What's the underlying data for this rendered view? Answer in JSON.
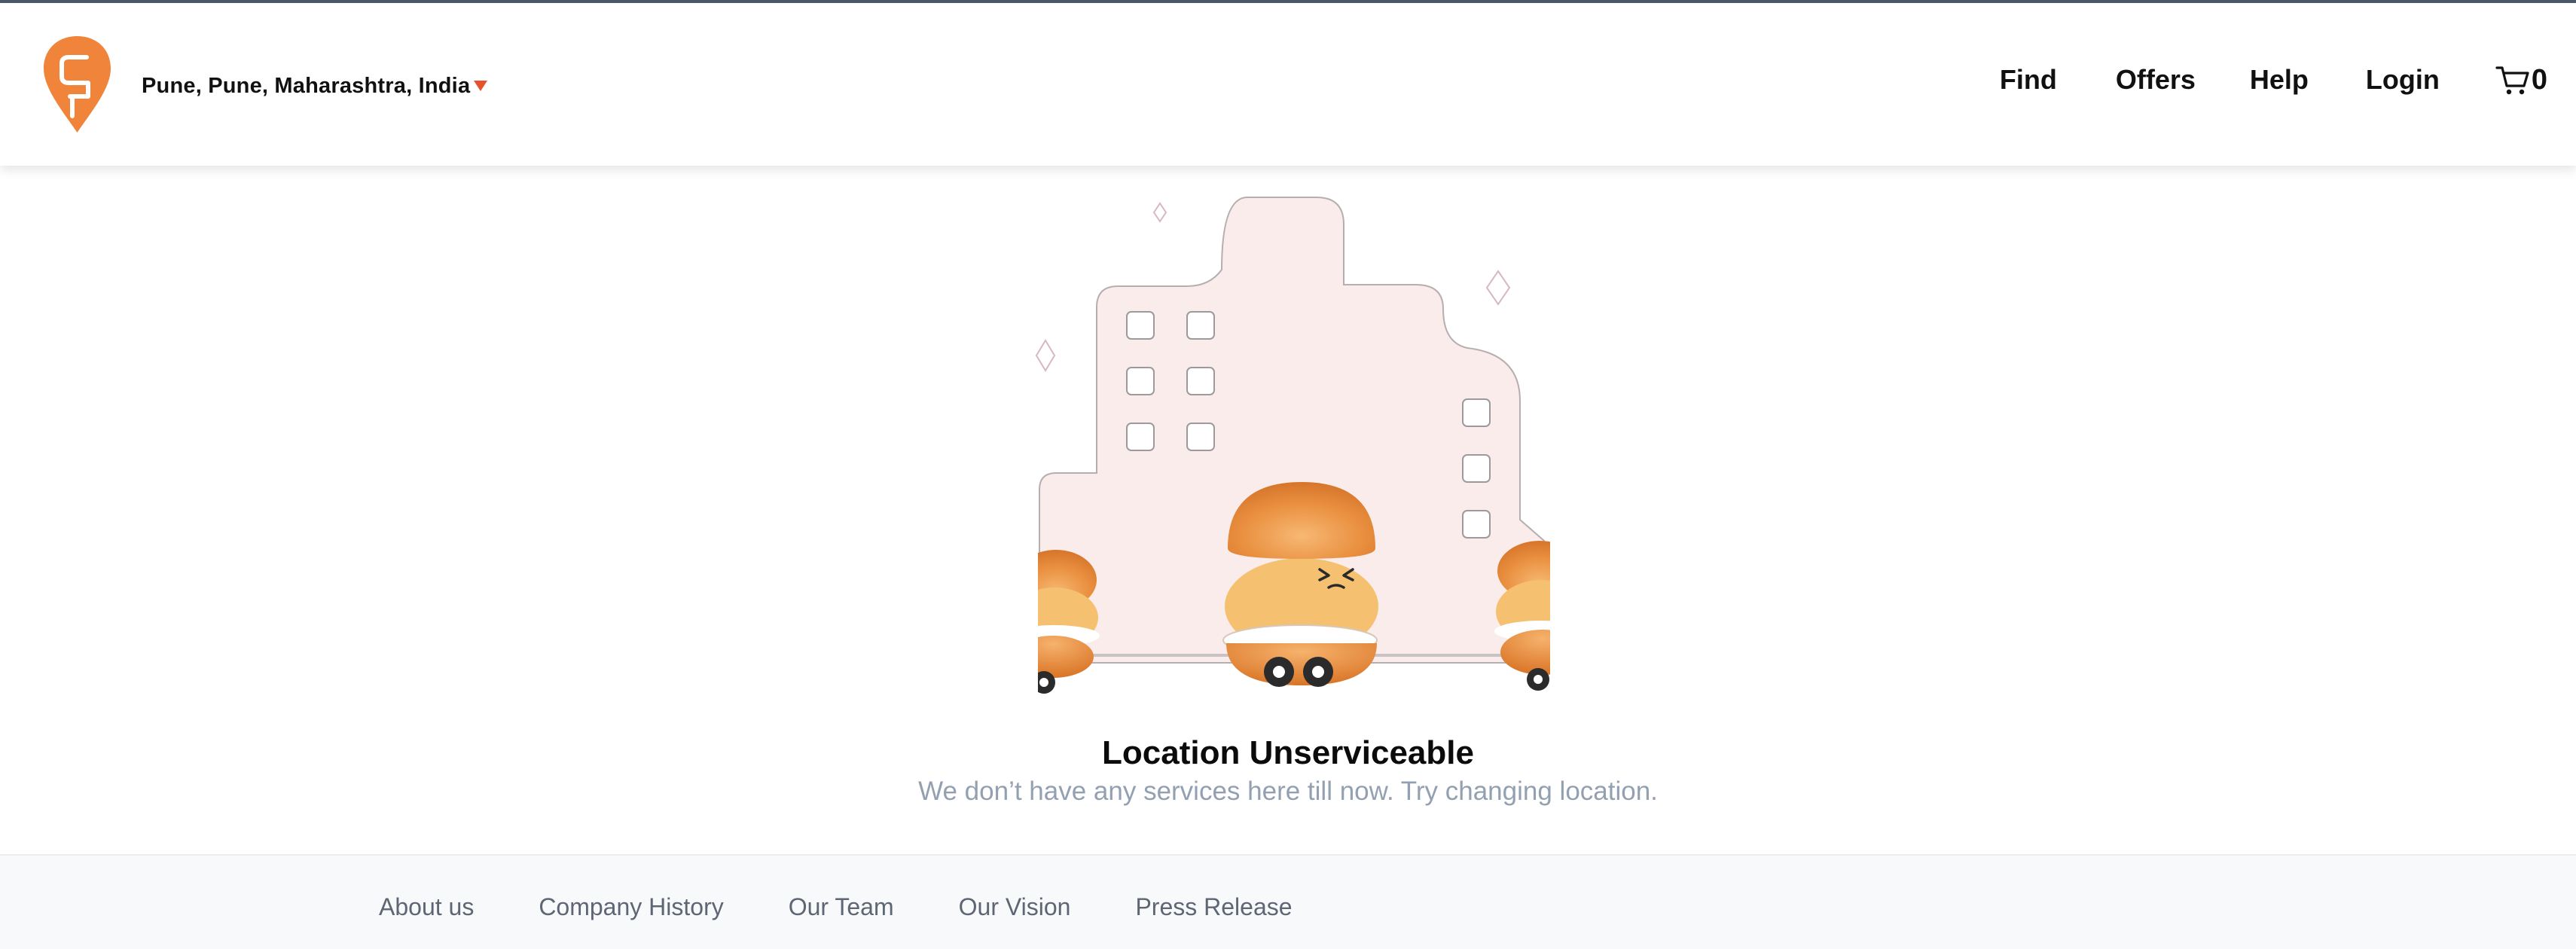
{
  "app": {
    "brand_color": "#f0843a",
    "accent_caret": "#e8512d"
  },
  "header": {
    "location": "Pune, Pune, Maharashtra, India",
    "nav": {
      "find": "Find",
      "offers": "Offers",
      "help": "Help",
      "login": "Login"
    },
    "cart": {
      "icon": "cart-icon",
      "count": "0"
    }
  },
  "main": {
    "illustration": "building-with-burger-carts",
    "title": "Location Unserviceable",
    "subtitle": "We don’t have any services here till now. Try changing location."
  },
  "footer": {
    "links": [
      "About us",
      "Company History",
      "Our Team",
      "Our Vision",
      "Press Release"
    ]
  }
}
